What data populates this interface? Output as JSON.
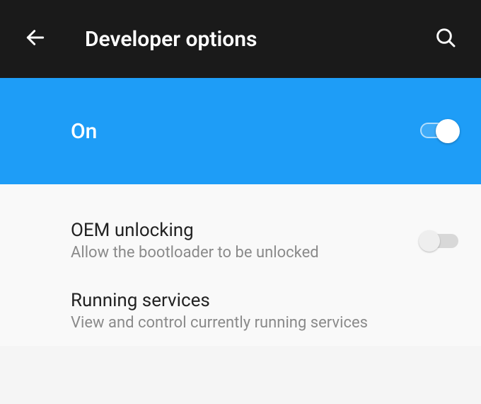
{
  "header": {
    "title": "Developer options"
  },
  "master_toggle": {
    "label": "On",
    "enabled": true
  },
  "settings": {
    "oem_unlocking": {
      "title": "OEM unlocking",
      "subtitle": "Allow the bootloader to be unlocked",
      "enabled": false
    },
    "running_services": {
      "title": "Running services",
      "subtitle": "View and control currently running services"
    }
  }
}
